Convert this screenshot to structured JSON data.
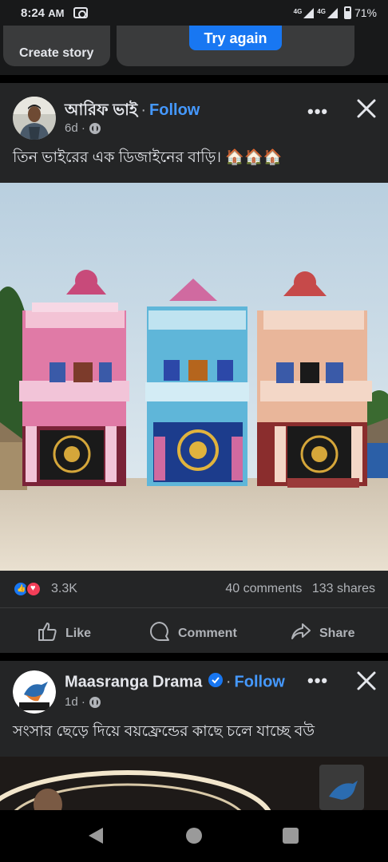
{
  "status_bar": {
    "time": "8:24",
    "meridiem": "AM",
    "network_1": "4G",
    "network_2": "4G",
    "battery": "71%"
  },
  "stories": {
    "create_label": "Create story",
    "retry_label": "Try again"
  },
  "posts": [
    {
      "author": "আরিফ ভাই",
      "separator": "·",
      "follow_label": "Follow",
      "time": "6d ·",
      "audience_icon": "globe-icon",
      "text": "তিন ভাইরের এক ডিজাইনের বাড়ি। 🏠🏠🏠",
      "image_description_icon": "houses-photo",
      "reaction_count": "3.3K",
      "comments": "40 comments",
      "shares": "133 shares",
      "actions": {
        "like": "Like",
        "comment": "Comment",
        "share": "Share"
      }
    },
    {
      "author": "Maasranga Drama",
      "verified": true,
      "separator": "·",
      "follow_label": "Follow",
      "time": "1d ·",
      "audience_icon": "globe-icon",
      "avatar_text": "maasranga drama",
      "text": "সংসার ছেড়ে দিয়ে বয়ফ্রেন্ডের কাছে চলে যাচ্ছে বউ"
    }
  ],
  "colors": {
    "background": "#18191a",
    "card": "#242526",
    "accent": "#1877f2",
    "link": "#4599ff",
    "secondary_text": "#b0b3b8"
  }
}
